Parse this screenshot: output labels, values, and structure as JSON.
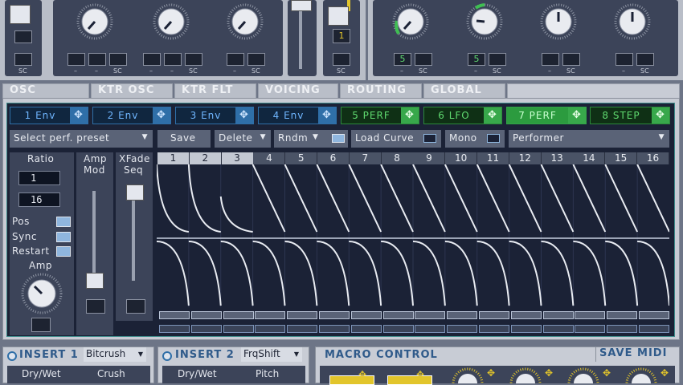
{
  "top": {
    "left_sc_labels": [
      "SC",
      "–",
      "–",
      "SC",
      "–",
      "–",
      "SC",
      "–",
      "SC",
      "SC"
    ],
    "mid_lcd_value": "1",
    "right_lcd_values": [
      "5",
      "5"
    ],
    "right_sc_labels": [
      "–",
      "SC",
      "–",
      "SC",
      "–",
      "SC",
      "–",
      "SC"
    ]
  },
  "tabs": [
    "OSC",
    "KTR OSC",
    "KTR FLT",
    "VOICING",
    "ROUTING",
    "GLOBAL"
  ],
  "mod_buttons": [
    {
      "label": "1 Env",
      "style": "blue"
    },
    {
      "label": "2 Env",
      "style": "blue"
    },
    {
      "label": "3 Env",
      "style": "blue"
    },
    {
      "label": "4 Env",
      "style": "blue"
    },
    {
      "label": "5 PERF",
      "style": "green"
    },
    {
      "label": "6 LFO",
      "style": "green"
    },
    {
      "label": "7 PERF",
      "style": "greenon"
    },
    {
      "label": "8 STEP",
      "style": "green"
    }
  ],
  "toolbar": {
    "preset_select": "Select perf. preset",
    "save": "Save",
    "delete": "Delete",
    "rndm": "Rndm",
    "load_curve": "Load Curve",
    "mono": "Mono",
    "performer": "Performer"
  },
  "left_panel": {
    "ratio_label": "Ratio",
    "ratio_num": "1",
    "ratio_den": "16",
    "pos": "Pos",
    "sync": "Sync",
    "restart": "Restart",
    "amp": "Amp",
    "amp_mod_line1": "Amp",
    "amp_mod_line2": "Mod",
    "xfade_line1": "XFade",
    "xfade_line2": "Seq"
  },
  "steps": [
    "1",
    "2",
    "3",
    "4",
    "5",
    "6",
    "7",
    "8",
    "9",
    "10",
    "11",
    "12",
    "13",
    "14",
    "15",
    "16"
  ],
  "bottom": {
    "insert1_title": "INSERT 1",
    "insert1_effect": "Bitcrush",
    "insert1_p1": "Dry/Wet",
    "insert1_p2": "Crush",
    "insert2_title": "INSERT 2",
    "insert2_effect": "FrqShift",
    "insert2_p1": "Dry/Wet",
    "insert2_p2": "Pitch",
    "macro_title": "MACRO CONTROL",
    "save_midi": "SAVE MIDI"
  },
  "colors": {
    "blue_accent": "#2f6fa8",
    "green_accent": "#38a84b",
    "yellow_accent": "#e2c52b",
    "panel_dark": "#1b2236"
  }
}
